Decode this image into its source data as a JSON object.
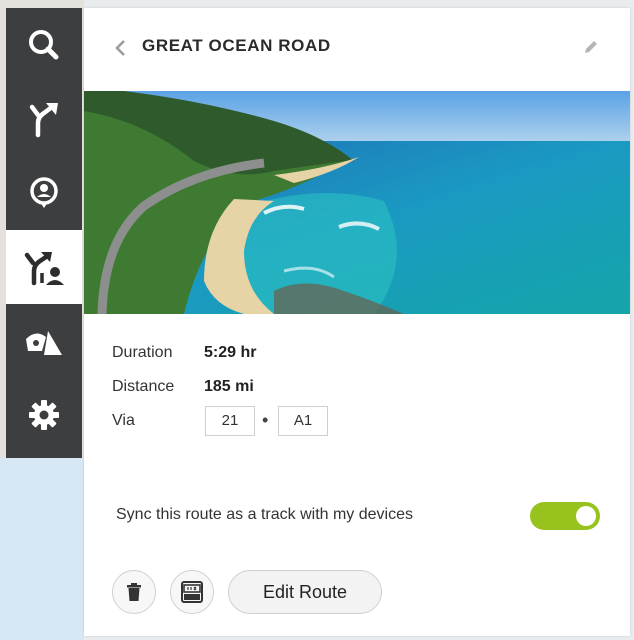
{
  "sidebar": {
    "items": [
      {
        "name": "search",
        "icon": "search-icon"
      },
      {
        "name": "directions",
        "icon": "directions-icon"
      },
      {
        "name": "places",
        "icon": "place-icon"
      },
      {
        "name": "my-routes",
        "icon": "my-routes-icon",
        "active": true
      },
      {
        "name": "map-layers",
        "icon": "map-layers-icon"
      },
      {
        "name": "settings",
        "icon": "gear-icon"
      }
    ]
  },
  "route": {
    "title": "GREAT OCEAN ROAD",
    "duration_label": "Duration",
    "duration_value": "5:29 hr",
    "distance_label": "Distance",
    "distance_value": "185 mi",
    "via_label": "Via",
    "via": [
      "21",
      "A1"
    ],
    "via_separator": "•"
  },
  "sync": {
    "label": "Sync this route as a track with my devices",
    "enabled": true
  },
  "actions": {
    "edit_route_label": "Edit Route"
  },
  "colors": {
    "accent_toggle": "#98c31f",
    "sidebar_bg": "#3d3e40",
    "panel_bg": "#ffffff"
  }
}
